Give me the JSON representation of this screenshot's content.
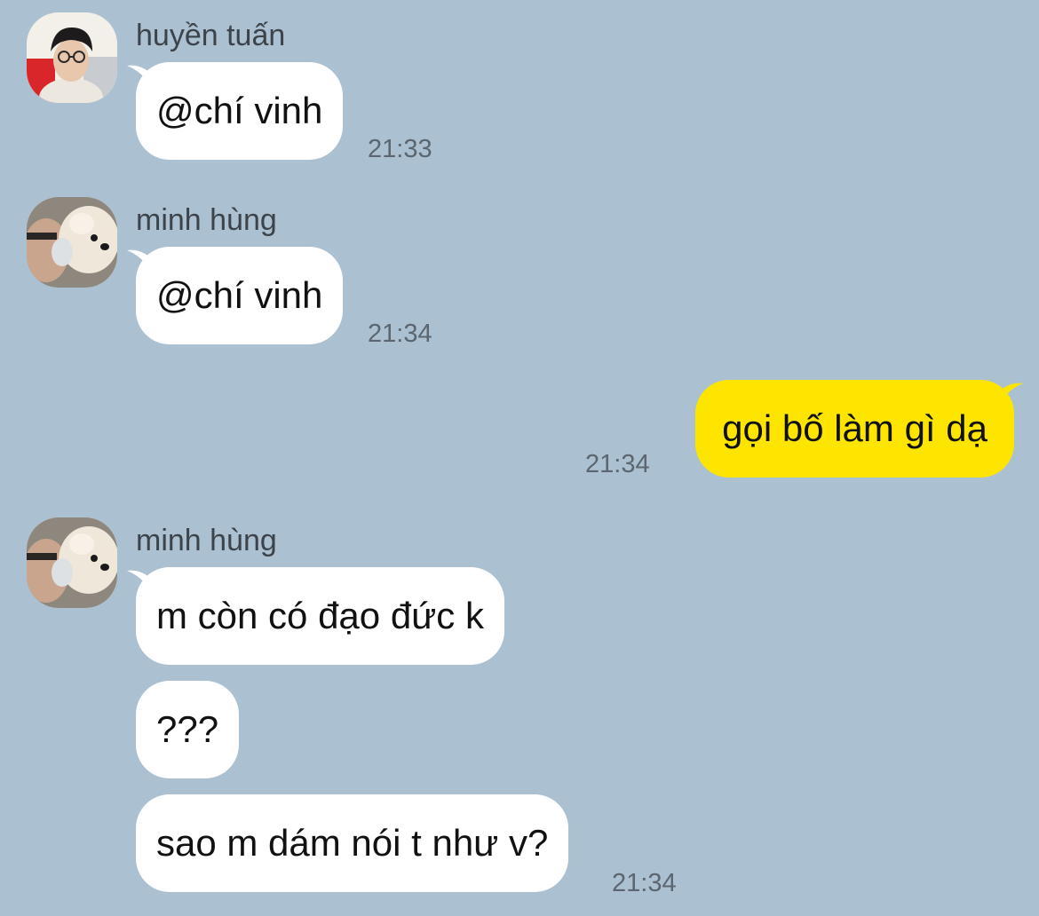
{
  "colors": {
    "background": "#abc1d1",
    "incoming_bubble": "#ffffff",
    "outgoing_bubble": "#fee500",
    "timestamp": "#5c6670",
    "sender_name": "#3c434b"
  },
  "messages": [
    {
      "sender": "huyền tuấn",
      "avatar_icon": "user-avatar-photo",
      "text": "@chí vinh",
      "time": "21:33"
    },
    {
      "sender": "minh hùng",
      "avatar_icon": "dog-avatar-photo",
      "text": "@chí vinh",
      "time": "21:34"
    },
    {
      "sender": "",
      "direction": "outgoing",
      "text": "gọi bố làm gì dạ",
      "time": "21:34"
    },
    {
      "sender": "minh hùng",
      "avatar_icon": "dog-avatar-photo",
      "texts": [
        "m còn có đạo đức k",
        "???",
        "sao m dám nói t như v?"
      ],
      "time": "21:34"
    }
  ]
}
